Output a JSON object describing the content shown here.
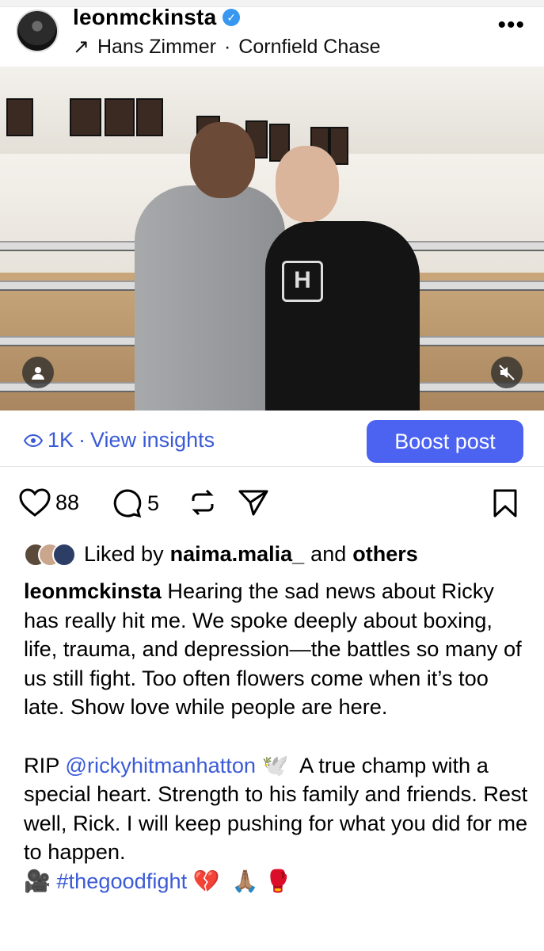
{
  "post": {
    "username": "leonmckinsta",
    "music_artist": "Hans Zimmer",
    "music_separator": "·",
    "music_track": "Cornfield Chase",
    "more_icon": "more-icon"
  },
  "insights": {
    "views": "1K",
    "separator": "·",
    "link": "View insights",
    "boost_label": "Boost post"
  },
  "actions": {
    "likes_count": "88",
    "comments_count": "5"
  },
  "liked_by": {
    "prefix": "Liked by",
    "user": "naima.malia_",
    "joiner": "and",
    "others": "others"
  },
  "caption": {
    "author": "leonmckinsta",
    "text_1": " Hearing the sad news about Ricky has really hit me. We spoke deeply about boxing, life, trauma, and depression—the battles so many of us still fight. Too often flowers come when it’s too late. Show love while people are here.\n\nRIP ",
    "mention": "@rickyhitmanhatton",
    "text_2": " 🕊️  A true champ with a special heart. Strength to his family and friends. Rest well, Rick. I will keep pushing for what you did for me to happen.\n🎥 ",
    "hashtag": "#thegoodfight",
    "text_3": " 💔  🙏🏽 🥊"
  },
  "colors": {
    "accent": "#4b63f0",
    "link": "#3b5bd6",
    "verified": "#3897f0"
  }
}
